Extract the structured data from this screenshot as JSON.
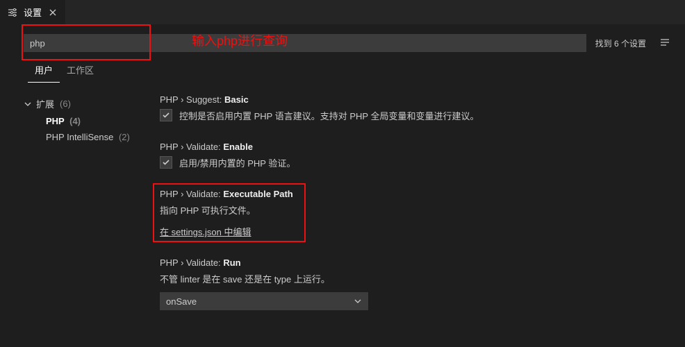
{
  "tab": {
    "title": "设置"
  },
  "search": {
    "value": "php",
    "annotation": "输入php进行查询",
    "found_label": "找到 6 个设置"
  },
  "scope_tabs": {
    "user": "用户",
    "workspace": "工作区"
  },
  "tree": {
    "header": "扩展",
    "header_count": "(6)",
    "items": [
      {
        "label": "PHP",
        "count": "(4)",
        "selected": true
      },
      {
        "label": "PHP IntelliSense",
        "count": "(2)",
        "selected": false
      }
    ]
  },
  "settings": [
    {
      "category": "PHP › Suggest:",
      "name": "Basic",
      "type": "checkbox",
      "checked": true,
      "desc": "控制是否启用内置 PHP 语言建议。支持对 PHP 全局变量和变量进行建议。"
    },
    {
      "category": "PHP › Validate:",
      "name": "Enable",
      "type": "checkbox",
      "checked": true,
      "desc": "启用/禁用内置的 PHP 验证。"
    },
    {
      "category": "PHP › Validate:",
      "name": "Executable Path",
      "type": "link",
      "desc": "指向 PHP 可执行文件。",
      "link_text": "在 settings.json 中编辑"
    },
    {
      "category": "PHP › Validate:",
      "name": "Run",
      "type": "select",
      "desc": "不管 linter 是在 save 还是在 type 上运行。",
      "value": "onSave"
    }
  ]
}
